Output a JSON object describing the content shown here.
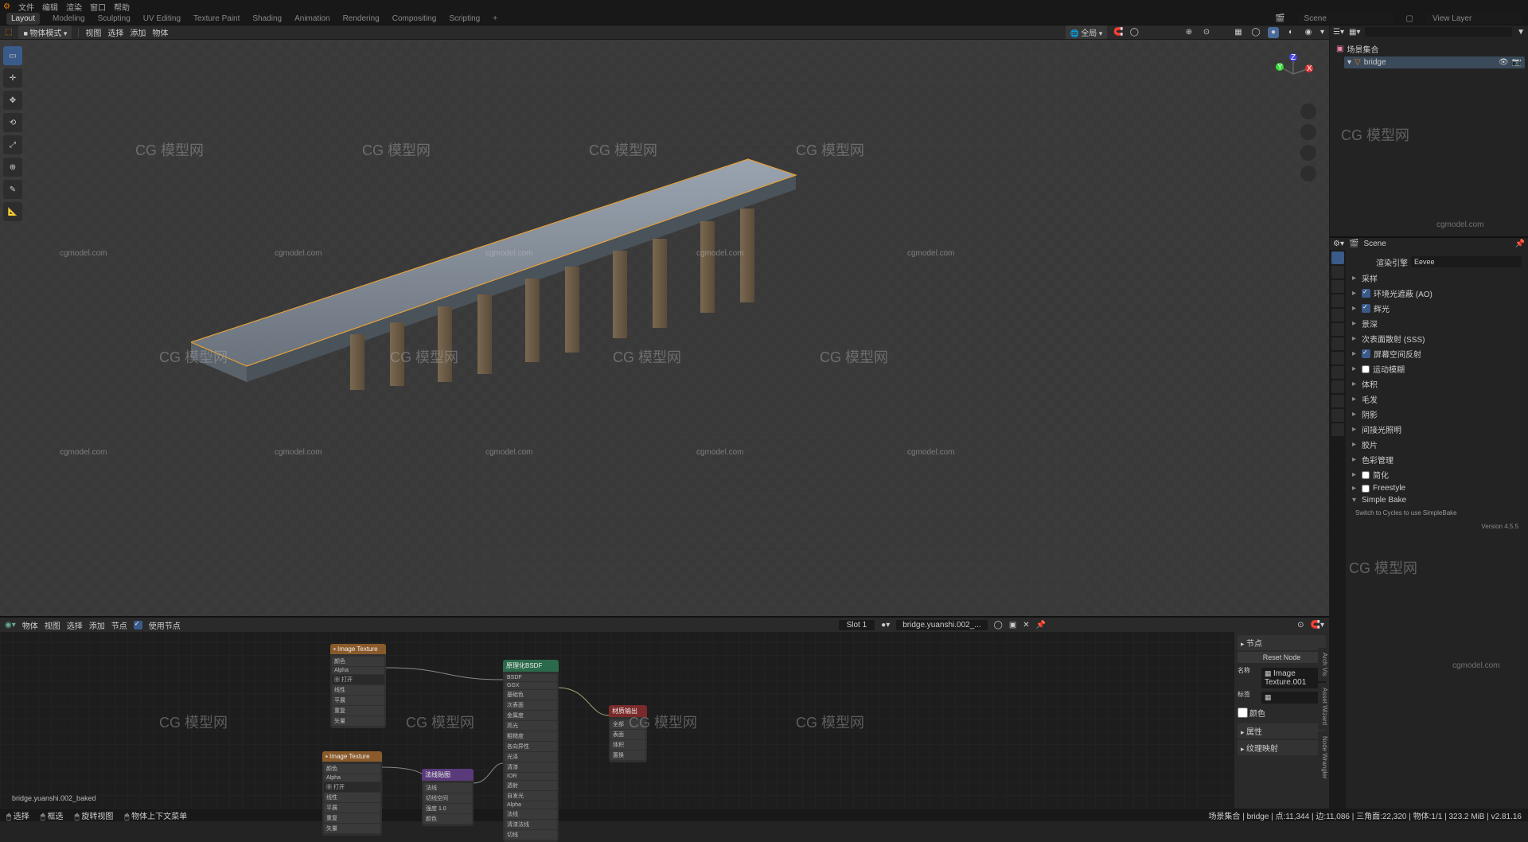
{
  "topmenu": {
    "file": "文件",
    "edit": "编辑",
    "render": "渲染",
    "window": "窗口",
    "help": "帮助"
  },
  "workspaces": {
    "layout": "Layout",
    "modeling": "Modeling",
    "sculpting": "Sculpting",
    "uv": "UV Editing",
    "texpaint": "Texture Paint",
    "shading": "Shading",
    "anim": "Animation",
    "render": "Rendering",
    "comp": "Compositing",
    "script": "Scripting",
    "add": "+"
  },
  "scene_field": "Scene",
  "viewlayer_field": "View Layer",
  "viewport": {
    "mode": "物体模式",
    "view": "视图",
    "select": "选择",
    "add": "添加",
    "object": "物体",
    "global": "全局"
  },
  "outliner": {
    "collection": "场景集合",
    "item": "bridge",
    "search_placeholder": ""
  },
  "props": {
    "breadcrumb_icon": "",
    "breadcrumb": "Scene",
    "render_engine_label": "渲染引擎",
    "render_engine": "Eevee",
    "sampling": "采样",
    "ao": "环境光遮蔽 (AO)",
    "bloom": "辉光",
    "dof": "景深",
    "sss": "次表面散射 (SSS)",
    "ssr": "屏幕空间反射",
    "motion": "运动模糊",
    "volume": "体积",
    "hair": "毛发",
    "shadow": "阴影",
    "indirect": "间接光照明",
    "film": "胶片",
    "color": "色彩管理",
    "simplify": "简化",
    "freestyle": "Freestyle",
    "simplebake": "Simple Bake",
    "switch_msg": "Switch to Cycles to use SimpleBake",
    "version": "Version 4.5.5"
  },
  "node": {
    "header": {
      "editor": "物体",
      "view": "视图",
      "select": "选择",
      "add": "添加",
      "node": "节点",
      "usenodes": "使用节点",
      "slot": "Slot 1",
      "material": "bridge.yuanshi.002_..."
    },
    "panel": {
      "nodes": "节点",
      "reset": "Reset Node",
      "name_label": "名称",
      "name": "Image Texture.001",
      "tag_label": "标签",
      "color_label": "颜色",
      "props": "属性",
      "texture": "纹理映射"
    },
    "tabs": {
      "arch": "Arch Vis",
      "asset": "Asset Wizard",
      "nw": "Node Wrangler"
    }
  },
  "status": {
    "left1": "选择",
    "left2": "框选",
    "left3": "旋转视图",
    "left4": "物体上下文菜单",
    "mat": "bridge.yuanshi.002_baked",
    "right": "场景集合 | bridge | 点:11,344 | 边:11,086 | 三角面:22,320 | 物体:1/1 | 323.2 MiB | v2.81.16"
  },
  "watermark": {
    "brand": "CG 模型网",
    "url": "cgmodel.com"
  }
}
